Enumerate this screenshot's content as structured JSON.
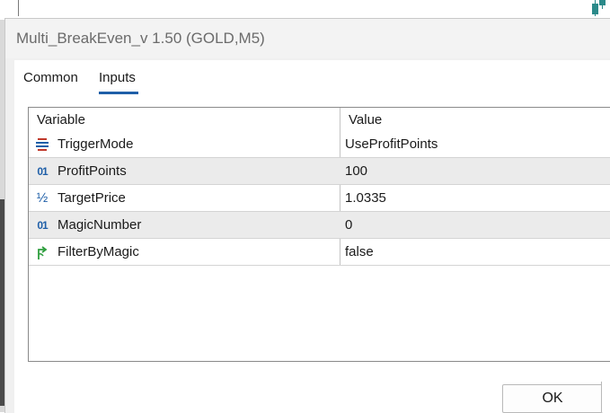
{
  "window": {
    "title": "Multi_BreakEven_v 1.50 (GOLD,M5)"
  },
  "tabs": [
    {
      "label": "Common",
      "active": false
    },
    {
      "label": "Inputs",
      "active": true
    }
  ],
  "table": {
    "columns": [
      "Variable",
      "Value"
    ],
    "rows": [
      {
        "icon": "enum-icon",
        "name": "TriggerMode",
        "value": "UseProfitPoints"
      },
      {
        "icon": "integer-icon",
        "name": "ProfitPoints",
        "value": "100"
      },
      {
        "icon": "double-icon",
        "name": "TargetPrice",
        "value": "1.0335"
      },
      {
        "icon": "integer-icon",
        "name": "MagicNumber",
        "value": "0"
      },
      {
        "icon": "bool-icon",
        "name": "FilterByMagic",
        "value": "false"
      }
    ]
  },
  "buttons": {
    "ok_label": "OK"
  },
  "colors": {
    "accent": "#1f5fa8",
    "enum_icon": "#c0392b",
    "bool_icon": "#2e9e3e",
    "alt_row": "#ebebeb",
    "chart_candle": "#2b8a8a"
  },
  "icon_glyphs": {
    "integer": "01",
    "double": "½"
  }
}
